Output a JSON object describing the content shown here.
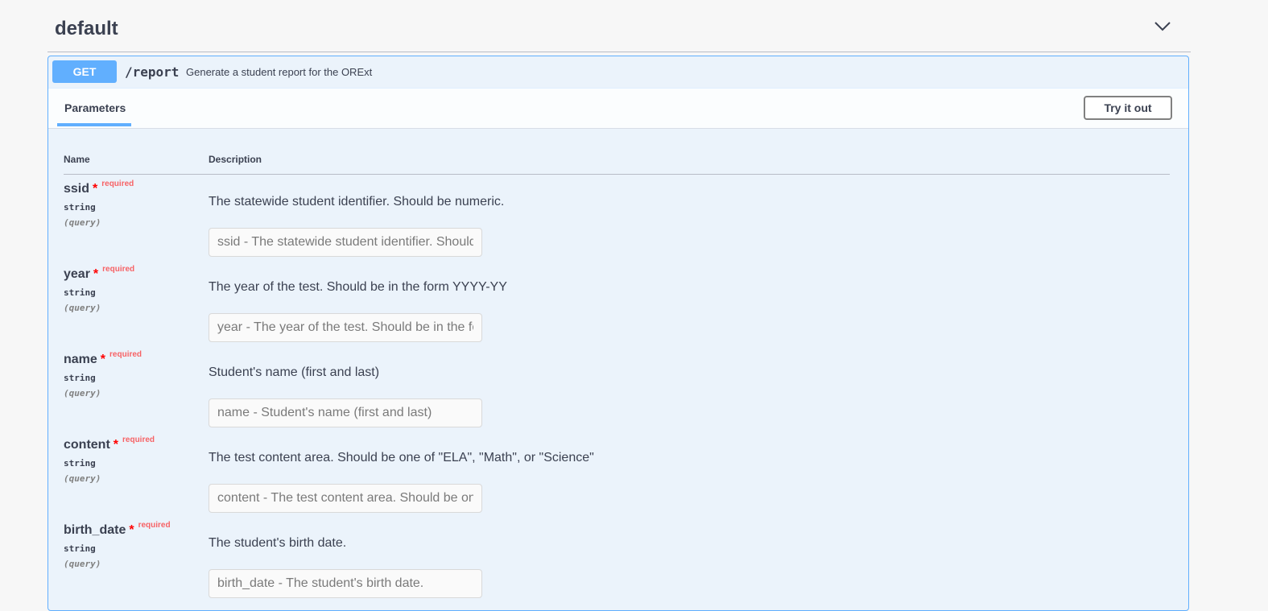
{
  "section": {
    "title": "default"
  },
  "operation": {
    "method": "GET",
    "path": "/report",
    "summary": "Generate a student report for the ORExt"
  },
  "tabs": {
    "parameters": "Parameters",
    "try_it_out": "Try it out"
  },
  "table_headers": {
    "name": "Name",
    "description": "Description"
  },
  "parameters": [
    {
      "name": "ssid",
      "star": "*",
      "required": "required",
      "type": "string",
      "in": "(query)",
      "description": "The statewide student identifier. Should be numeric.",
      "placeholder": "ssid - The statewide student identifier. Should be numeric."
    },
    {
      "name": "year",
      "star": "*",
      "required": "required",
      "type": "string",
      "in": "(query)",
      "description": "The year of the test. Should be in the form YYYY-YY",
      "placeholder": "year - The year of the test. Should be in the form YYYY-YY"
    },
    {
      "name": "name",
      "star": "*",
      "required": "required",
      "type": "string",
      "in": "(query)",
      "description": "Student's name (first and last)",
      "placeholder": "name - Student's name (first and last)"
    },
    {
      "name": "content",
      "star": "*",
      "required": "required",
      "type": "string",
      "in": "(query)",
      "description": "The test content area. Should be one of \"ELA\", \"Math\", or \"Science\"",
      "placeholder": "content - The test content area. Should be one of \"ELA\", \"Math\", or \"Science\""
    },
    {
      "name": "birth_date",
      "star": "*",
      "required": "required",
      "type": "string",
      "in": "(query)",
      "description": "The student's birth date.",
      "placeholder": "birth_date - The student's birth date."
    }
  ]
}
